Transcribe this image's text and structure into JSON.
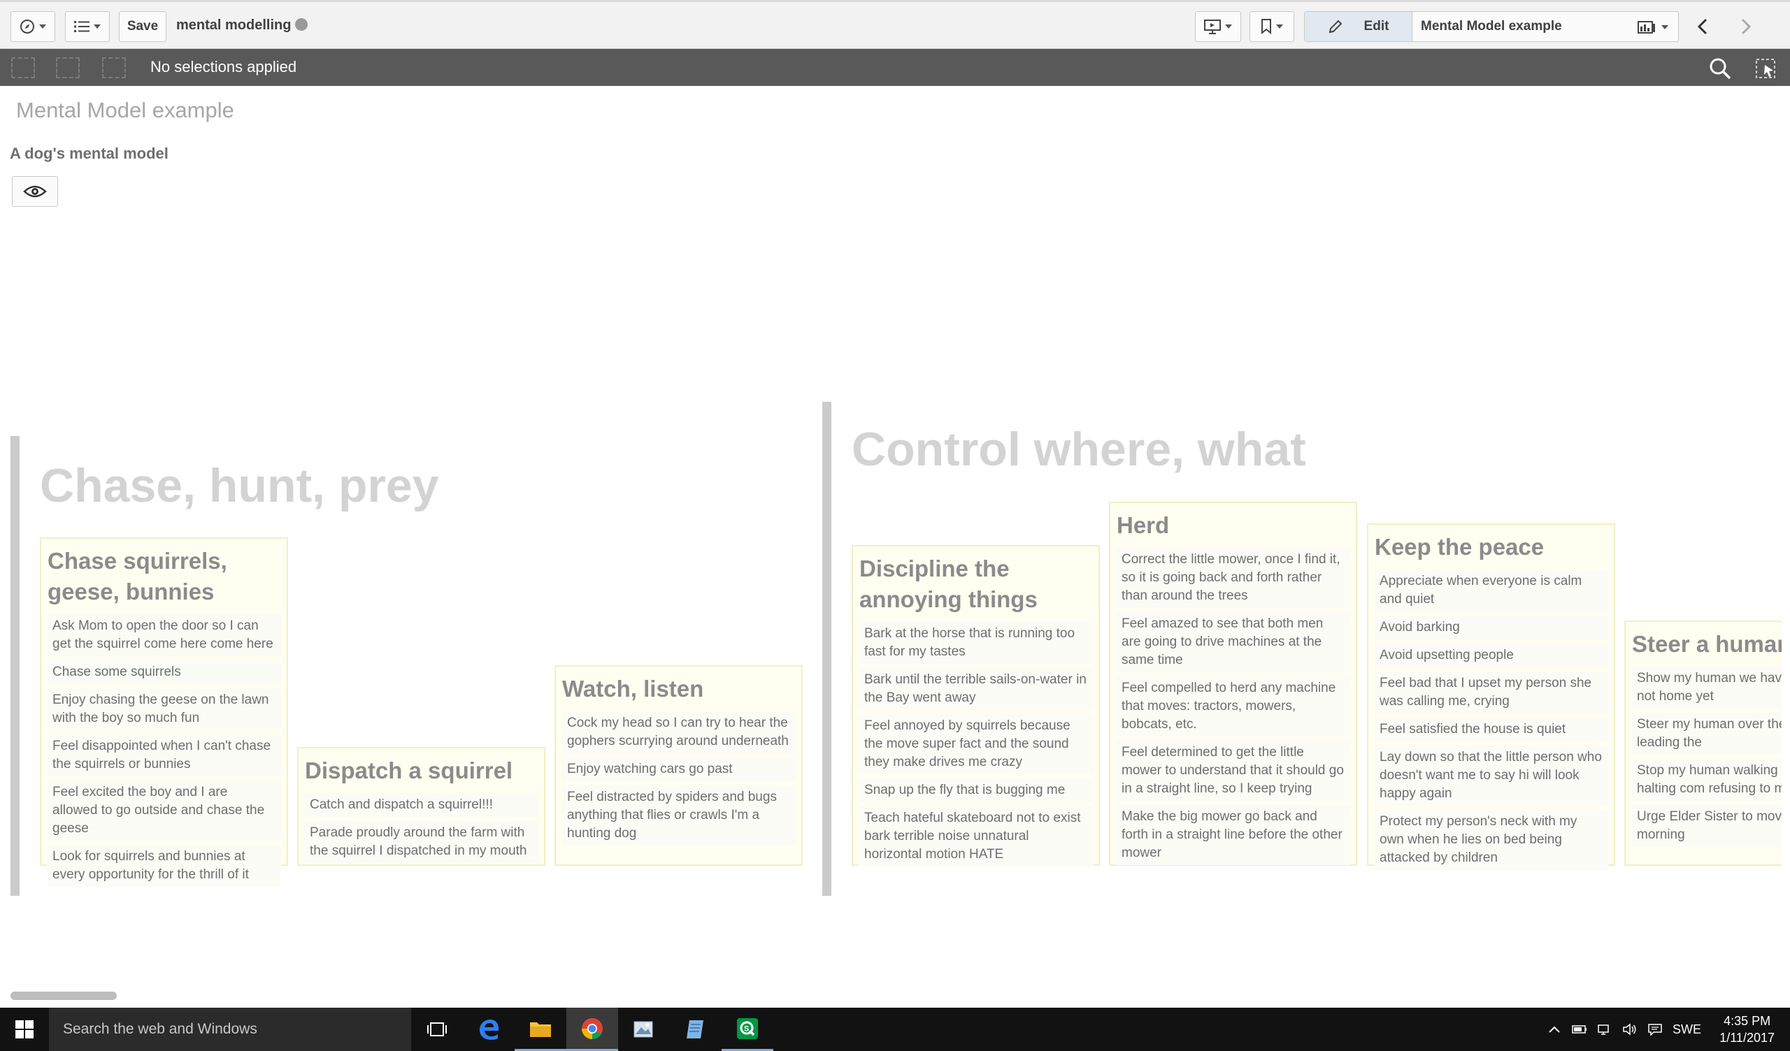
{
  "toolbar": {
    "save_label": "Save",
    "app_title": "mental modelling",
    "edit_label": "Edit",
    "sheet_name": "Mental Model example"
  },
  "selections": {
    "status": "No selections applied"
  },
  "sheet": {
    "title": "Mental Model example",
    "subtitle": "A dog's mental model"
  },
  "groups": [
    {
      "title": "Chase, hunt, prey",
      "cards": [
        {
          "title": "Chase squirrels, geese, bunnies",
          "items": [
            "Ask Mom to open the door so I can get the squirrel come here come here",
            "Chase some squirrels",
            "Enjoy chasing the geese on the lawn with the boy so much fun",
            "Feel disappointed when I can't chase the squirrels or bunnies",
            "Feel excited the boy and I are allowed to go outside and chase the geese",
            "Look for squirrels and bunnies at every opportunity for the thrill of it"
          ]
        },
        {
          "title": "Dispatch a squirrel",
          "items": [
            "Catch and dispatch a squirrel!!!",
            "Parade proudly around the farm with the squirrel I dispatched in my mouth"
          ]
        },
        {
          "title": "Watch, listen",
          "items": [
            "Cock my head so I can try to hear the gophers scurrying around underneath",
            "Enjoy watching cars go past",
            "Feel distracted by spiders and bugs anything that flies or crawls I'm a hunting dog"
          ]
        }
      ]
    },
    {
      "title": "Control where, what",
      "cards": [
        {
          "title": "Discipline the annoying things",
          "items": [
            "Bark at the horse that is running too fast for my tastes",
            "Bark until the terrible sails-on-water in the Bay went away",
            "Feel annoyed by squirrels because the move super fact and the sound they make drives me crazy",
            "Snap up the fly that is bugging me",
            "Teach hateful skateboard not to exist bark terrible noise unnatural horizontal motion HATE"
          ]
        },
        {
          "title": "Herd",
          "items": [
            "Correct the little mower, once I find it, so it is going back and forth rather than around the trees",
            "Feel amazed to see that both men are going to drive machines at the same time",
            "Feel compelled to herd any machine that moves: tractors, mowers, bobcats, etc.",
            "Feel determined to get the little mower to understand that it should go in a straight line, so I keep trying",
            "Make the big mower go back and forth in a straight line before the other mower"
          ]
        },
        {
          "title": "Keep the peace",
          "items": [
            "Appreciate when everyone is calm and quiet",
            "Avoid barking",
            "Avoid upsetting people",
            "Feel bad that I upset my person she was calling me, crying",
            "Feel satisfied the house is quiet",
            "Lay down so that the little person who doesn't want me to say hi will look happy again",
            "Protect my person's neck with my own when he lies on bed being attacked by children"
          ]
        },
        {
          "title": "Steer a human",
          "items": [
            "Show my human we have the park, not home yet",
            "Steer my human over the contact and leading the",
            "Stop my human walking direction by halting com refusing to move",
            "Urge Elder Sister to move faster this morning"
          ]
        }
      ]
    }
  ],
  "taskbar": {
    "search_placeholder": "Search the web and Windows",
    "language": "SWE",
    "time": "4:35 PM",
    "date": "1/11/2017"
  },
  "icons": {
    "accent": "#009845",
    "chrome": [
      "#db4437",
      "#f4b400",
      "#0f9d58",
      "#4285f4"
    ]
  }
}
